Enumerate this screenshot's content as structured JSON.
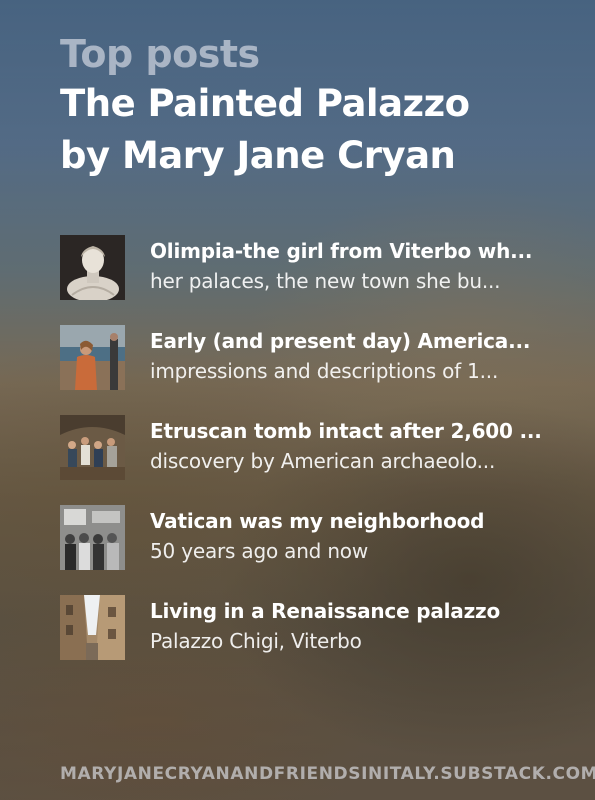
{
  "header": {
    "kicker": "Top posts",
    "title_line1": "The Painted Palazzo",
    "title_line2": "by Mary Jane Cryan"
  },
  "posts": [
    {
      "title": "Olimpia-the girl from Viterbo wh...",
      "subtitle": "her palaces, the new town she bu...",
      "thumbnail": "marble-bust-photo"
    },
    {
      "title": "Early (and present day) America...",
      "subtitle": "impressions and descriptions of 1...",
      "thumbnail": "woman-by-sea-photo"
    },
    {
      "title": "Etruscan tomb intact after 2,600 ...",
      "subtitle": "discovery by American archaeolo...",
      "thumbnail": "group-in-tomb-photo"
    },
    {
      "title": "Vatican was my neighborhood",
      "subtitle": "50 years ago and now",
      "thumbnail": "vintage-group-photo"
    },
    {
      "title": "Living in a Renaissance palazzo",
      "subtitle": "Palazzo Chigi, Viterbo",
      "thumbnail": "narrow-street-photo"
    }
  ],
  "footer": {
    "url": "MARYJANECRYANANDFRIENDSINITALY.SUBSTACK.COM"
  },
  "colors": {
    "title_text": "#ffffff",
    "kicker_text": "#c8ced8",
    "footer_text": "#cdcdd2"
  }
}
